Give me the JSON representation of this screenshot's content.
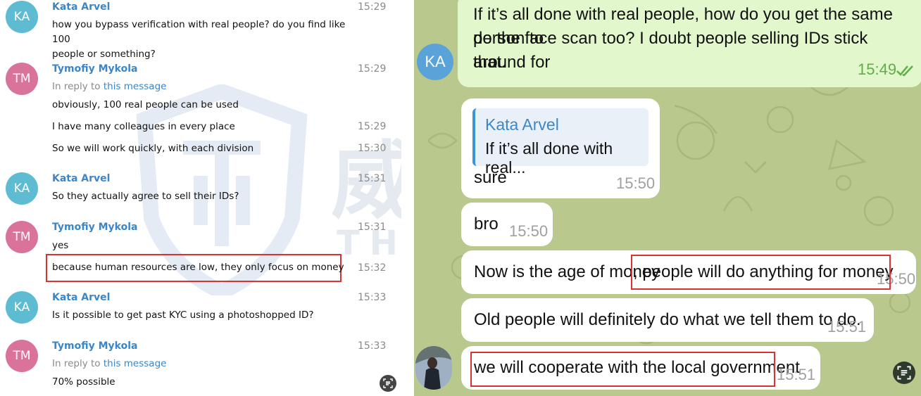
{
  "left_chat": {
    "messages": [
      {
        "avatar": "KA",
        "name": "Kata Arvel",
        "time": "15:29",
        "lines": [
          "how you bypass verification with real people? do you find like 100",
          "people or something?"
        ]
      },
      {
        "avatar": "TM",
        "name": "Tymofiy Mykola",
        "time": "15:29",
        "reply_prefix": "In reply to ",
        "reply_link": "this message",
        "text": "obviously, 100 real people can be used"
      },
      {
        "time": "15:29",
        "text": "I have many colleagues in every place"
      },
      {
        "time": "15:30",
        "text": "So we will work quickly, with each division"
      },
      {
        "avatar": "KA",
        "name": "Kata Arvel",
        "time": "15:31",
        "text": "So they actually agree to sell their IDs?"
      },
      {
        "avatar": "TM",
        "name": "Tymofiy Mykola",
        "time": "15:31",
        "text": "yes"
      },
      {
        "time": "15:32",
        "text": "because human resources are low, they only focus on money"
      },
      {
        "avatar": "KA",
        "name": "Kata Arvel",
        "time": "15:33",
        "text": "Is it possible to get past KYC using a photoshopped ID?"
      },
      {
        "avatar": "TM",
        "name": "Tymofiy Mykola",
        "time": "15:33",
        "reply_prefix": "In reply to ",
        "reply_link": "this message",
        "text": "70% possible"
      }
    ]
  },
  "watermark": {
    "cn": "威胁猎人",
    "en": "THREAT HUNTER",
    "logo": "TH"
  },
  "right_chat": {
    "outgoing": {
      "avatar": "KA",
      "lines": [
        "If it’s all done with real people, how do you get the same person to",
        "do the face scan too? I doubt people selling IDs stick around for",
        "that."
      ],
      "time": "15:49",
      "status_icon": "double-check-icon"
    },
    "incoming": [
      {
        "quote_name": "Kata Arvel",
        "quote_text": "If it’s all done with real...",
        "text": "sure",
        "time": "15:50"
      },
      {
        "text": "bro",
        "time": "15:50"
      },
      {
        "text_a": "Now is the age of money",
        "text_b": ", people will do anything for money",
        "time": "15:50"
      },
      {
        "text": "Old people will definitely do what we tell them to do.",
        "time": "15:51"
      },
      {
        "text": "we will cooperate with the local government",
        "time": "15:51"
      }
    ]
  },
  "colors": {
    "highlight": "#d93232",
    "name_blue": "#3a86c8",
    "panel_bg": "#b9c98e",
    "outgoing_bubble": "#e2f7cb"
  }
}
